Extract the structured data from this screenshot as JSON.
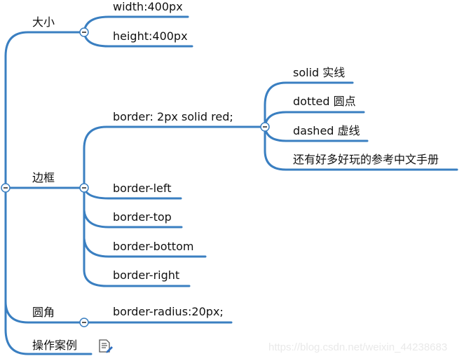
{
  "mindmap": {
    "line_color": "#3a7fc1",
    "root_branches": [
      {
        "label": "大小",
        "children": [
          {
            "label": "width:400px"
          },
          {
            "label": "height:400px"
          }
        ]
      },
      {
        "label": "边框",
        "children": [
          {
            "label": "border: 2px solid red;",
            "children": [
              {
                "label": "solid 实线"
              },
              {
                "label": "dotted 圆点"
              },
              {
                "label": "dashed 虚线"
              },
              {
                "label": "还有好多好玩的参考中文手册"
              }
            ]
          },
          {
            "label": "border-left"
          },
          {
            "label": "border-top"
          },
          {
            "label": "border-bottom"
          },
          {
            "label": "border-right"
          }
        ]
      },
      {
        "label": "圆角",
        "children": [
          {
            "label": "border-radius:20px;"
          }
        ]
      },
      {
        "label": "操作案例",
        "note_icon": "note-edit-icon"
      }
    ]
  },
  "watermark": "https://blog.csdn.net/weixin_44238683"
}
